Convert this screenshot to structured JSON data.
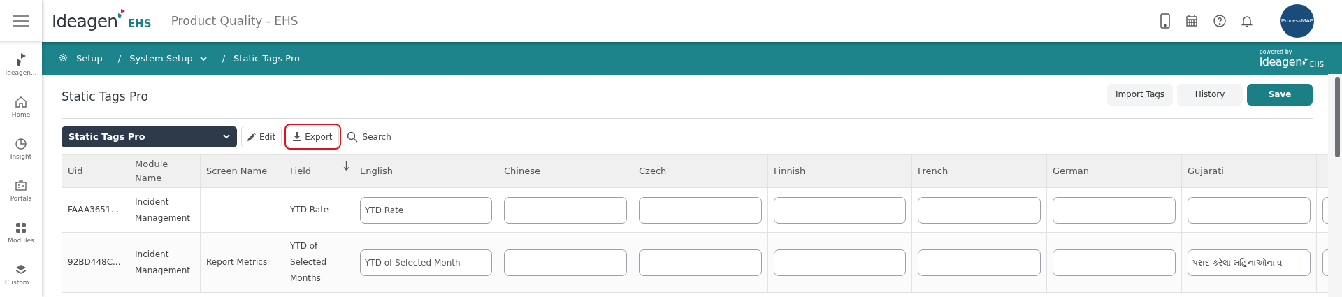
{
  "header": {
    "logo": {
      "name": "Ideagen",
      "suffix": "EHS"
    },
    "title": "Product Quality - EHS",
    "avatar_text": "ProcessMAP"
  },
  "sidebar": {
    "items": [
      {
        "label": "Ideagen..."
      },
      {
        "label": "Home"
      },
      {
        "label": "Insight"
      },
      {
        "label": "Portals"
      },
      {
        "label": "Modules"
      },
      {
        "label": "Custom ..."
      }
    ]
  },
  "breadcrumb": {
    "items": [
      {
        "label": "Setup",
        "kind": "root"
      },
      {
        "label": "System Setup",
        "kind": "dropdown",
        "separator": "/"
      },
      {
        "label": "Static Tags Pro",
        "kind": "current",
        "separator": "/"
      }
    ],
    "powered_by": {
      "caption": "powered by",
      "name": "Ideagen",
      "suffix": "EHS"
    }
  },
  "page": {
    "title": "Static Tags Pro",
    "buttons": [
      {
        "label": "Import Tags",
        "kind": "secondary"
      },
      {
        "label": "History",
        "kind": "secondary"
      },
      {
        "label": "Save",
        "kind": "primary"
      }
    ]
  },
  "toolbar": {
    "select": "Static Tags Pro",
    "edit": "Edit",
    "export": "Export",
    "search_placeholder": "Search",
    "export_highlighted": true
  },
  "table": {
    "columns": [
      {
        "label": "Uid",
        "kind": "text"
      },
      {
        "label": "Module Name",
        "kind": "text"
      },
      {
        "label": "Screen Name",
        "kind": "text"
      },
      {
        "label": "Field",
        "kind": "text",
        "sorted": true
      },
      {
        "label": "English",
        "kind": "input"
      },
      {
        "label": "Chinese",
        "kind": "input"
      },
      {
        "label": "Czech",
        "kind": "input"
      },
      {
        "label": "Finnish",
        "kind": "input"
      },
      {
        "label": "French",
        "kind": "input"
      },
      {
        "label": "German",
        "kind": "input"
      },
      {
        "label": "Gujarati",
        "kind": "input"
      }
    ],
    "rows": [
      {
        "cells": [
          "FAAA3651...",
          "Incident Management",
          "",
          "YTD Rate",
          "YTD Rate",
          "",
          "",
          "",
          "",
          "",
          ""
        ]
      },
      {
        "cells": [
          "92BD448C...",
          "Incident Management",
          "Report Metrics",
          "YTD of Selected Months",
          "YTD of Selected Month",
          "",
          "",
          "",
          "",
          "",
          "પસંદ કરેલા મહિનાઓના વ"
        ]
      }
    ]
  }
}
